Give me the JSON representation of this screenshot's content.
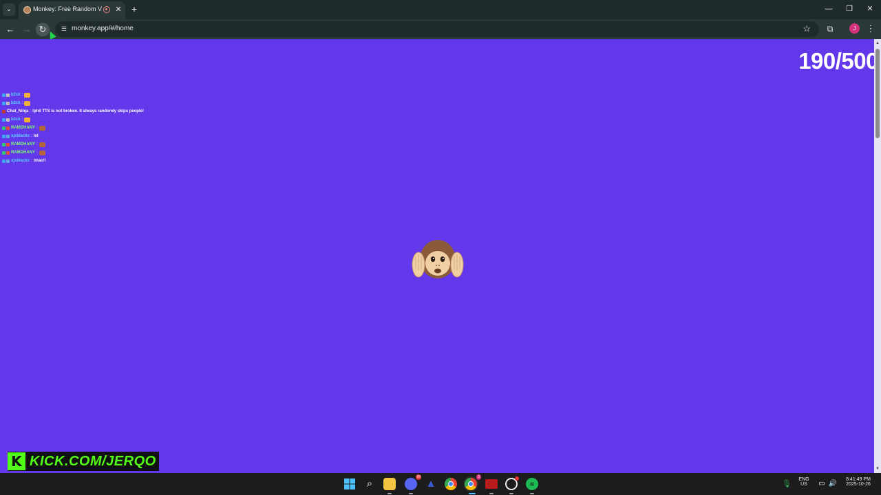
{
  "browser": {
    "tab_title": "Monkey: Free Random Vide",
    "url": "monkey.app/#/home",
    "profile_initial": "J",
    "icons": {
      "tab_search": "chevron-down-icon",
      "tab_close": "close-icon",
      "new_tab": "plus-icon",
      "minimize": "minimize-icon",
      "restore": "restore-icon",
      "close_window": "close-icon",
      "back": "back-arrow-icon",
      "forward": "forward-arrow-icon",
      "reload": "reload-icon",
      "site_info": "tune-icon",
      "bookmark": "star-icon",
      "extensions": "puzzle-icon",
      "menu": "kebab-menu-icon"
    }
  },
  "page": {
    "background_color": "#6238ea",
    "counter": "190/500",
    "chat": [
      {
        "user": "b2ck",
        "sep": ":",
        "msg": "",
        "user_color": "#5ad7ff",
        "emote": "#f2b134",
        "badges": [
          "#3fa9f5",
          "#c0c0c0"
        ]
      },
      {
        "user": "b2ck",
        "sep": ":",
        "msg": "",
        "user_color": "#5ad7ff",
        "emote": "#f2b134",
        "badges": [
          "#3fa9f5",
          "#c0c0c0"
        ]
      },
      {
        "user": "Chat_Ninja",
        "sep": ":",
        "msg": "!phil TTS is not broken. It always randomly skips people!",
        "user_color": "#ffffff",
        "emote": "",
        "badges": [
          "#c0392b"
        ]
      },
      {
        "user": "b2ck",
        "sep": ":",
        "msg": "",
        "user_color": "#5ad7ff",
        "emote": "#f2b134",
        "badges": [
          "#3fa9f5",
          "#c0c0c0"
        ]
      },
      {
        "user": "RAMDHANY",
        "sep": ":",
        "msg": "",
        "user_color": "#7dff6a",
        "emote": "#b5653a",
        "badges": [
          "#2ecc71",
          "#e74c3c"
        ]
      },
      {
        "user": "xjxblackx",
        "sep": ":",
        "msg": "lol",
        "user_color": "#5ad7ff",
        "emote": "",
        "badges": [
          "#3fa9f5",
          "#5dade2"
        ]
      },
      {
        "user": "RAMDHANY",
        "sep": ":",
        "msg": "",
        "user_color": "#7dff6a",
        "emote": "#b5653a",
        "badges": [
          "#2ecc71",
          "#e74c3c"
        ]
      },
      {
        "user": "RAMDHANY",
        "sep": ":",
        "msg": "",
        "user_color": "#7dff6a",
        "emote": "#b5653a",
        "badges": [
          "#2ecc71",
          "#e74c3c"
        ]
      },
      {
        "user": "xjxblackx",
        "sep": ":",
        "msg": "lmao!!",
        "user_color": "#5ad7ff",
        "emote": "",
        "badges": [
          "#3fa9f5",
          "#5dade2"
        ]
      }
    ],
    "center_icon": "hear-no-evil-monkey-icon",
    "kick_logo": "K",
    "kick_url": "KICK.COM/JERQO",
    "kick_color": "#53fc18"
  },
  "taskbar": {
    "apps": [
      "windows-start-icon",
      "search-icon",
      "file-explorer-icon",
      "discord-icon",
      "arc-icon",
      "chrome-icon",
      "chrome-profile-icon",
      "obs-icon",
      "steelseries-icon",
      "spotify-icon"
    ],
    "discord_badge": "99",
    "chrome_badge": "3",
    "lang_top": "ENG",
    "lang_bottom": "US",
    "time": "8:41:49 PM",
    "date": "2025-10-26"
  }
}
